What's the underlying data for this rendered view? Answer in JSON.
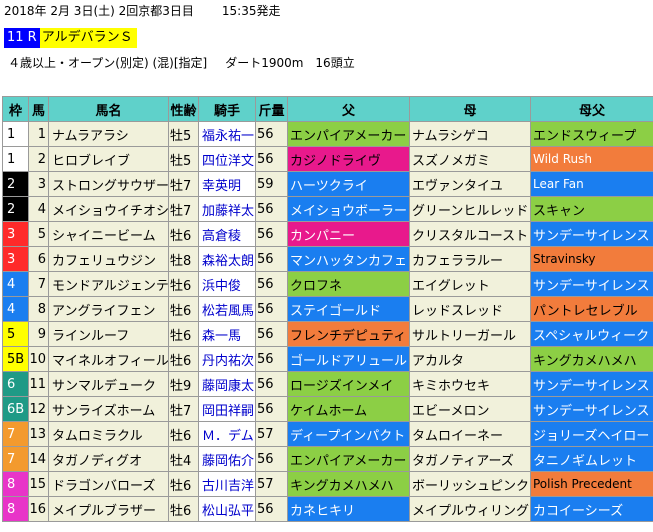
{
  "header": {
    "date": "2018年 2月 3日(土) 2回京都3日目",
    "start_time": "15:35発走"
  },
  "race": {
    "number": "11 R",
    "name": "アルデバランＳ"
  },
  "conditions": {
    "class": "４歳以上・オープン(別定) (混)[指定]",
    "course": "ダート1900m",
    "runners": "16頭立"
  },
  "colors": {
    "header_bg": "#5fd1ca",
    "row_cream": "#f1f1db",
    "jockey_text": "#0000cc",
    "green": "#8ccf45",
    "magenta": "#e8198c",
    "blue": "#1a7ef0",
    "orange": "#f27c3c",
    "sand": "#e9e4bd"
  },
  "table": {
    "headers": [
      "枠",
      "馬",
      "馬名",
      "性齢",
      "騎手",
      "斤量",
      "父",
      "母",
      "母父"
    ],
    "rows": [
      {
        "waku": "1",
        "waku_bg": "#ffffff",
        "waku_fg": "#000000",
        "num": "1",
        "name": "ナムラアラシ",
        "sex": "牡5",
        "jockey": "福永祐一",
        "weight": "56",
        "father": "エンパイアメーカー",
        "father_bg": "#8ccf45",
        "father_fg": "#000000",
        "mother": "ナムラシゲコ",
        "mfather": "エンドスウィープ",
        "mf_bg": "#8ccf45",
        "mf_fg": "#000000"
      },
      {
        "waku": "1",
        "waku_bg": "#ffffff",
        "waku_fg": "#000000",
        "num": "2",
        "name": "ヒロブレイブ",
        "sex": "牡5",
        "jockey": "四位洋文",
        "weight": "56",
        "father": "カジノドライヴ",
        "father_bg": "#e8198c",
        "father_fg": "#000000",
        "mother": "スズノメガミ",
        "mfather": "Wild Rush",
        "mf_bg": "#f27c3c",
        "mf_fg": "#ffffff"
      },
      {
        "waku": "2",
        "waku_bg": "#000000",
        "waku_fg": "#ffffff",
        "num": "3",
        "name": "ストロングサウザー",
        "sex": "牡7",
        "jockey": "幸英明",
        "weight": "59",
        "father": "ハーツクライ",
        "father_bg": "#1a7ef0",
        "father_fg": "#ffffff",
        "mother": "エヴァンタイユ",
        "mfather": "Lear Fan",
        "mf_bg": "#1a7ef0",
        "mf_fg": "#ffffff"
      },
      {
        "waku": "2",
        "waku_bg": "#000000",
        "waku_fg": "#ffffff",
        "num": "4",
        "name": "メイショウイチオシ",
        "sex": "牡7",
        "jockey": "加藤祥太",
        "weight": "56",
        "father": "メイショウボーラー",
        "father_bg": "#1a7ef0",
        "father_fg": "#ffffff",
        "mother": "グリーンヒルレッド",
        "mfather": "スキャン",
        "mf_bg": "#8ccf45",
        "mf_fg": "#000000"
      },
      {
        "waku": "3",
        "waku_bg": "#ff2a2a",
        "waku_fg": "#ffffff",
        "num": "5",
        "name": "シャイニービーム",
        "sex": "牡6",
        "jockey": "高倉稜",
        "weight": "56",
        "father": "カンパニー",
        "father_bg": "#e8198c",
        "father_fg": "#ffffff",
        "mother": "クリスタルコースト",
        "mfather": "サンデーサイレンス",
        "mf_bg": "#1a7ef0",
        "mf_fg": "#ffffff"
      },
      {
        "waku": "3",
        "waku_bg": "#ff2a2a",
        "waku_fg": "#ffffff",
        "num": "6",
        "name": "カフェリュウジン",
        "sex": "牡8",
        "jockey": "森裕太朗",
        "weight": "56",
        "father": "マンハッタンカフェ",
        "father_bg": "#1a7ef0",
        "father_fg": "#ffffff",
        "mother": "カフェララルー",
        "mfather": "Stravinsky",
        "mf_bg": "#f27c3c",
        "mf_fg": "#000000"
      },
      {
        "waku": "4",
        "waku_bg": "#1a7ef0",
        "waku_fg": "#ffffff",
        "num": "7",
        "name": "モンドアルジェンテ",
        "sex": "牡6",
        "jockey": "浜中俊",
        "weight": "56",
        "father": "クロフネ",
        "father_bg": "#8ccf45",
        "father_fg": "#000000",
        "mother": "エイグレット",
        "mfather": "サンデーサイレンス",
        "mf_bg": "#1a7ef0",
        "mf_fg": "#ffffff"
      },
      {
        "waku": "4",
        "waku_bg": "#1a7ef0",
        "waku_fg": "#ffffff",
        "num": "8",
        "name": "アングライフェン",
        "sex": "牡6",
        "jockey": "松若風馬",
        "weight": "56",
        "father": "ステイゴールド",
        "father_bg": "#1a7ef0",
        "father_fg": "#ffffff",
        "mother": "レッドスレッド",
        "mfather": "パントレセレブル",
        "mf_bg": "#f27c3c",
        "mf_fg": "#000000"
      },
      {
        "waku": "5",
        "waku_bg": "#ffff00",
        "waku_fg": "#000000",
        "num": "9",
        "name": "ラインルーフ",
        "sex": "牡6",
        "jockey": "森一馬",
        "weight": "56",
        "father": "フレンチデピュティ",
        "father_bg": "#f27c3c",
        "father_fg": "#000000",
        "mother": "サルトリーガール",
        "mfather": "スペシャルウィーク",
        "mf_bg": "#1a7ef0",
        "mf_fg": "#ffffff"
      },
      {
        "waku": "5B",
        "waku_bg": "#ffff00",
        "waku_fg": "#000000",
        "num": "10",
        "name": "マイネルオフィール",
        "sex": "牡6",
        "jockey": "丹内祐次",
        "weight": "56",
        "father": "ゴールドアリュール",
        "father_bg": "#1a7ef0",
        "father_fg": "#ffffff",
        "mother": "アカルタ",
        "mfather": "キングカメハメハ",
        "mf_bg": "#8ccf45",
        "mf_fg": "#000000"
      },
      {
        "waku": "6",
        "waku_bg": "#1f9a86",
        "waku_fg": "#ffffff",
        "num": "11",
        "name": "サンマルデューク",
        "sex": "牡9",
        "jockey": "藤岡康太",
        "weight": "56",
        "father": "ロージズインメイ",
        "father_bg": "#8ccf45",
        "father_fg": "#000000",
        "mother": "キミホウセキ",
        "mfather": "サンデーサイレンス",
        "mf_bg": "#1a7ef0",
        "mf_fg": "#ffffff"
      },
      {
        "waku": "6B",
        "waku_bg": "#1f9a86",
        "waku_fg": "#ffffff",
        "num": "12",
        "name": "サンライズホーム",
        "sex": "牡7",
        "jockey": "岡田祥嗣",
        "weight": "56",
        "father": "ケイムホーム",
        "father_bg": "#8ccf45",
        "father_fg": "#000000",
        "mother": "エビーメロン",
        "mfather": "サンデーサイレンス",
        "mf_bg": "#1a7ef0",
        "mf_fg": "#ffffff"
      },
      {
        "waku": "7",
        "waku_bg": "#f39a2e",
        "waku_fg": "#ffffff",
        "num": "13",
        "name": "タムロミラクル",
        "sex": "牡6",
        "jockey": "Ｍ．デム",
        "weight": "57",
        "father": "ディープインパクト",
        "father_bg": "#1a7ef0",
        "father_fg": "#ffffff",
        "mother": "タムロイーネー",
        "mfather": "ジョリーズヘイロー",
        "mf_bg": "#1a7ef0",
        "mf_fg": "#ffffff"
      },
      {
        "waku": "7",
        "waku_bg": "#f39a2e",
        "waku_fg": "#ffffff",
        "num": "14",
        "name": "タガノディグオ",
        "sex": "牡4",
        "jockey": "藤岡佑介",
        "weight": "56",
        "father": "エンパイアメーカー",
        "father_bg": "#8ccf45",
        "father_fg": "#000000",
        "mother": "タガノティアーズ",
        "mfather": "タニノギムレット",
        "mf_bg": "#1a7ef0",
        "mf_fg": "#ffffff"
      },
      {
        "waku": "8",
        "waku_bg": "#e834c8",
        "waku_fg": "#ffffff",
        "num": "15",
        "name": "ドラゴンバローズ",
        "sex": "牡6",
        "jockey": "古川吉洋",
        "weight": "57",
        "father": "キングカメハメハ",
        "father_bg": "#8ccf45",
        "father_fg": "#000000",
        "mother": "ボーリッシュピンク",
        "mfather": "Polish Precedent",
        "mf_bg": "#f27c3c",
        "mf_fg": "#000000"
      },
      {
        "waku": "8",
        "waku_bg": "#e834c8",
        "waku_fg": "#ffffff",
        "num": "16",
        "name": "メイプルブラザー",
        "sex": "牡6",
        "jockey": "松山弘平",
        "weight": "56",
        "father": "カネヒキリ",
        "father_bg": "#1a7ef0",
        "father_fg": "#ffffff",
        "mother": "メイプルウィリング",
        "mfather": "カコイーシーズ",
        "mf_bg": "#1a7ef0",
        "mf_fg": "#ffffff"
      }
    ]
  }
}
